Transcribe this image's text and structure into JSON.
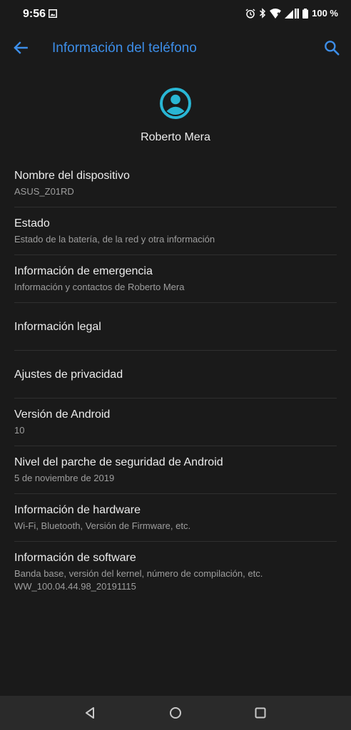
{
  "status_bar": {
    "time": "9:56",
    "battery": "100 %",
    "icons": [
      "image-icon",
      "alarm-icon",
      "bluetooth-icon",
      "wifi-icon",
      "signal-icon",
      "battery-icon"
    ]
  },
  "app_bar": {
    "title": "Información del teléfono",
    "accent_color": "#3d8ee8",
    "icons": [
      "back-arrow-icon",
      "search-icon"
    ]
  },
  "profile": {
    "name": "Roberto Mera",
    "icon": "account-circle-icon",
    "icon_color": "#29b6d4"
  },
  "items": [
    {
      "title": "Nombre del dispositivo",
      "subtitle": "ASUS_Z01RD"
    },
    {
      "title": "Estado",
      "subtitle": "Estado de la batería, de la red y otra información"
    },
    {
      "title": "Información de emergencia",
      "subtitle": "Información y contactos de Roberto Mera"
    },
    {
      "title": "Información legal"
    },
    {
      "title": "Ajustes de privacidad"
    },
    {
      "title": "Versión de Android",
      "subtitle": "10"
    },
    {
      "title": "Nivel del parche de seguridad de Android",
      "subtitle": "5 de noviembre de 2019"
    },
    {
      "title": "Información de hardware",
      "subtitle": "Wi-Fi, Bluetooth, Versión de Firmware, etc."
    },
    {
      "title": "Información de software",
      "subtitle": "Banda base, versión del kernel, número de compilación, etc.",
      "subtitle2": "WW_100.04.44.98_20191115"
    }
  ],
  "nav_bar": {
    "icons": [
      "back-triangle-icon",
      "home-circle-icon",
      "recents-square-icon"
    ]
  }
}
